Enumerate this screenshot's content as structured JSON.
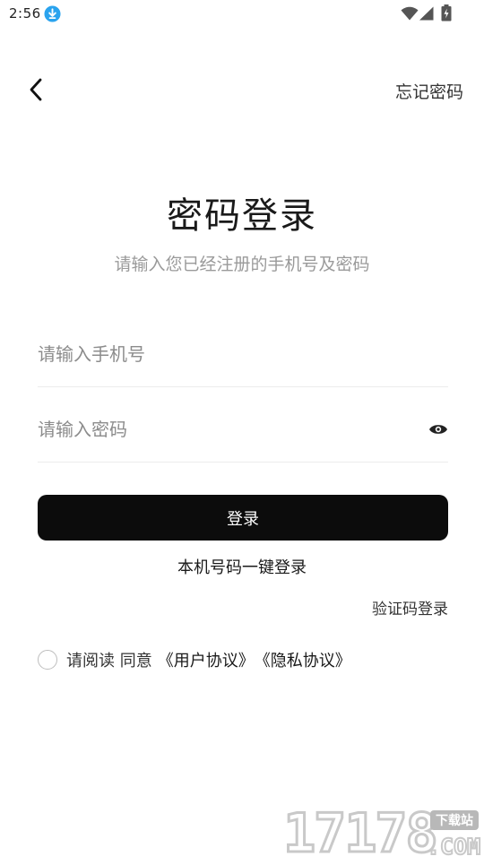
{
  "status_bar": {
    "time": "2:56",
    "icons": [
      "download-icon",
      "wifi-icon",
      "signal-icon",
      "battery-icon"
    ],
    "download_color": "#2aa3ee"
  },
  "header": {
    "back_icon": "back-arrow-icon",
    "forgot_password": "忘记密码"
  },
  "title": "密码登录",
  "subtitle": "请输入您已经注册的手机号及密码",
  "form": {
    "phone": {
      "value": "",
      "placeholder": "请输入手机号"
    },
    "password": {
      "value": "",
      "placeholder": "请输入密码",
      "toggle_icon": "eye-icon"
    }
  },
  "login_button": "登录",
  "one_key_login": "本机号码一键登录",
  "sms_login": "验证码登录",
  "agreement": {
    "checked": false,
    "text": "请阅读 同意",
    "user_agreement": "《用户协议》",
    "privacy_agreement": "《隐私协议》"
  },
  "watermark": {
    "digits": "17178",
    "badge": "下载站",
    "domain": ".COM"
  },
  "colors": {
    "primary_button": "#0c0c0c",
    "subtitle": "#9a9a9a",
    "placeholder": "#8c8c8c",
    "divider": "#ececec"
  }
}
